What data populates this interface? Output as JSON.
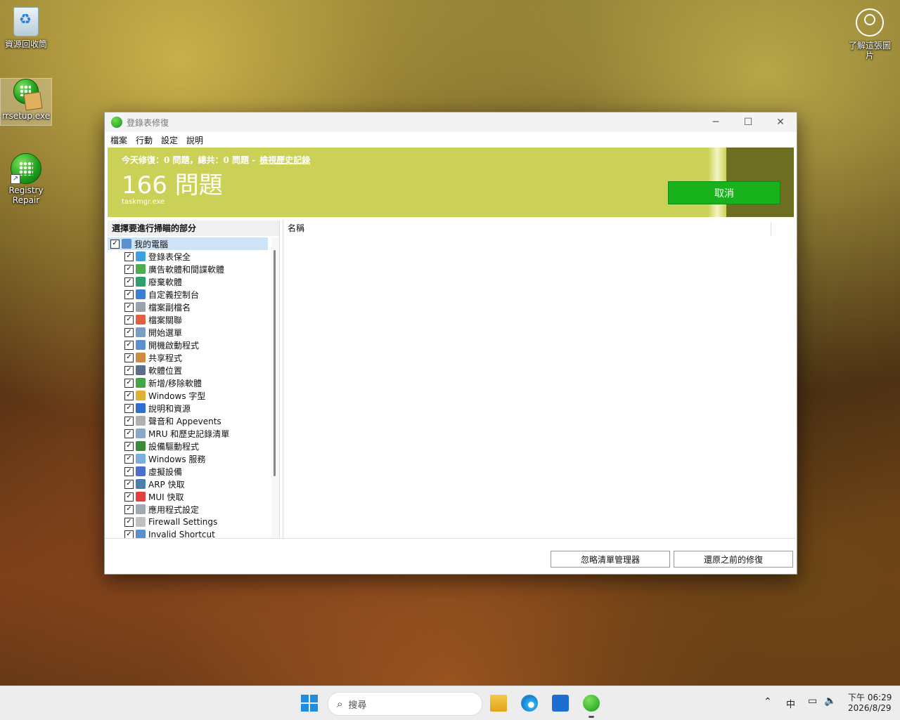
{
  "desktop": {
    "icons": [
      {
        "label": "資源回收筒"
      },
      {
        "label": "rrsetup.exe"
      },
      {
        "label": "Registry\nRepair"
      },
      {
        "label": "了解這張圖\n片"
      }
    ]
  },
  "window": {
    "title": "登錄表修復",
    "controls": {
      "minimize": "─",
      "maximize": "☐",
      "close": "✕"
    },
    "menu": [
      "檔案",
      "行動",
      "設定",
      "說明"
    ],
    "banner": {
      "summary": "今天修復：0 問題，總共：0 問題 -",
      "history_link": "檢視歷史記錄",
      "count": "166 問題",
      "process": "taskmgr.exe",
      "cancel_label": "取消",
      "colors": {
        "banner": "#cbd156",
        "dark": "#6d6e22",
        "button": "#17b21c"
      }
    },
    "left_pane": {
      "heading": "選擇要進行掃瞄的部分",
      "root": {
        "label": "我的電腦",
        "checked": true
      },
      "items": [
        {
          "label": "登錄表保全",
          "icon": "grid-icon",
          "color": "#3aa0e0"
        },
        {
          "label": "廣告軟體和間諜軟體",
          "icon": "spyware-icon",
          "color": "#4caf50"
        },
        {
          "label": "廢棄軟體",
          "icon": "trash-icon",
          "color": "#2e9e6a"
        },
        {
          "label": "自定義控制台",
          "icon": "control-panel-icon",
          "color": "#3b7fd1"
        },
        {
          "label": "檔案副檔名",
          "icon": "file-ext-icon",
          "color": "#9aa3ad"
        },
        {
          "label": "檔案關聯",
          "icon": "file-assoc-icon",
          "color": "#e06040"
        },
        {
          "label": "開始選單",
          "icon": "start-menu-icon",
          "color": "#7a9cc6"
        },
        {
          "label": "開機啟動程式",
          "icon": "startup-icon",
          "color": "#5a8fd0"
        },
        {
          "label": "共享程式",
          "icon": "shared-icon",
          "color": "#d08a40"
        },
        {
          "label": "軟體位置",
          "icon": "software-path-icon",
          "color": "#5a6f8a"
        },
        {
          "label": "新增/移除軟體",
          "icon": "add-remove-icon",
          "color": "#45a545"
        },
        {
          "label": "Windows 字型",
          "icon": "font-icon",
          "color": "#e0b030"
        },
        {
          "label": "說明和資源",
          "icon": "help-icon",
          "color": "#2f6fd0"
        },
        {
          "label": "聲音和 Appevents",
          "icon": "sound-icon",
          "color": "#b0b0b0"
        },
        {
          "label": "MRU 和歷史記錄清單",
          "icon": "history-icon",
          "color": "#8aa8c8"
        },
        {
          "label": "設備驅動程式",
          "icon": "driver-icon",
          "color": "#3a8a3a"
        },
        {
          "label": "Windows 服務",
          "icon": "service-icon",
          "color": "#7ab0e0"
        },
        {
          "label": "虛擬設備",
          "icon": "virtual-device-icon",
          "color": "#4a6fd0"
        },
        {
          "label": "ARP 快取",
          "icon": "arp-icon",
          "color": "#4a7fb0"
        },
        {
          "label": "MUI 快取",
          "icon": "mui-icon",
          "color": "#e04040"
        },
        {
          "label": "應用程式設定",
          "icon": "app-settings-icon",
          "color": "#a0a8b0"
        },
        {
          "label": "Firewall Settings",
          "icon": "firewall-icon",
          "color": "#c0c0c0"
        },
        {
          "label": "Invalid Shortcut",
          "icon": "shortcut-icon",
          "color": "#5a90d0"
        }
      ]
    },
    "right_pane": {
      "column_name": "名稱"
    },
    "buttons": {
      "ignore_list": "忽略清單管理器",
      "restore": "還原之前的修復"
    }
  },
  "taskbar": {
    "search_placeholder": "搜尋",
    "tray": {
      "ime": "中",
      "time": "下午 06:29",
      "date": "2026/8/29"
    }
  }
}
